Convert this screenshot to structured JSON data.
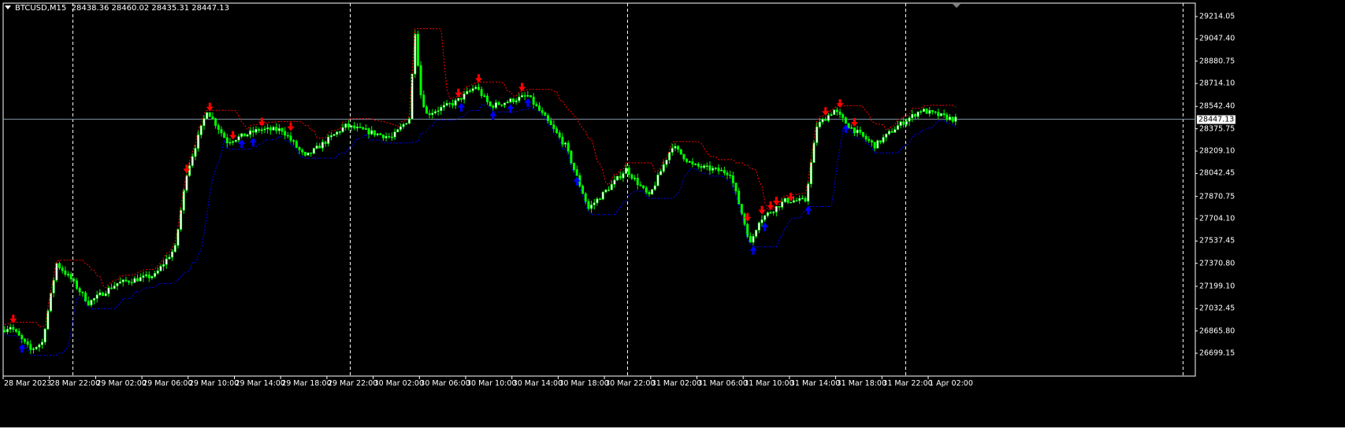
{
  "window": {
    "symbol_timeframe": "BTCUSD,M15",
    "ohlc": "28438.36 28460.02 28435.31 28447.13",
    "menu_icon": "triangle-down-icon"
  },
  "colors": {
    "background": "#000000",
    "candle": "#00ff00",
    "candle_alt": "#ffffff",
    "upper_band": "#ff0000",
    "lower_band": "#0000ff",
    "sell_arrow": "#ff0000",
    "buy_arrow": "#0000ff",
    "bid_line": "#8090a0",
    "grid": "#ffffff"
  },
  "chart_data": {
    "type": "candlestick",
    "timeframe": "M15",
    "price_axis": {
      "ticks": [
        "29214.05",
        "29047.40",
        "28880.75",
        "28714.10",
        "28542.40",
        "28375.75",
        "28209.10",
        "28042.45",
        "27870.75",
        "27704.10",
        "27537.45",
        "27370.80",
        "27199.10",
        "27032.45",
        "26865.80",
        "26699.15"
      ],
      "range": [
        26699.15,
        29214.05
      ]
    },
    "bid_price": "28447.13",
    "time_axis": {
      "ticks": [
        "28 Mar 2023",
        "28 Mar 22:00",
        "29 Mar 02:00",
        "29 Mar 06:00",
        "29 Mar 10:00",
        "29 Mar 14:00",
        "29 Mar 18:00",
        "29 Mar 22:00",
        "30 Mar 02:00",
        "30 Mar 06:00",
        "30 Mar 10:00",
        "30 Mar 14:00",
        "30 Mar 18:00",
        "30 Mar 22:00",
        "31 Mar 02:00",
        "31 Mar 06:00",
        "31 Mar 10:00",
        "31 Mar 14:00",
        "31 Mar 18:00",
        "31 Mar 22:00",
        "1 Apr 02:00"
      ],
      "start": "28 Mar 2023 18:00",
      "day_separators": [
        "29 Mar 00:00",
        "30 Mar 00:00",
        "31 Mar 00:00",
        "1 Apr 00:00",
        "2 Apr 00:00"
      ]
    },
    "price_path": [
      [
        "28 Mar 18:00",
        26870
      ],
      [
        "28 Mar 18:45",
        26900
      ],
      [
        "28 Mar 20:30",
        26723
      ],
      [
        "28 Mar 21:30",
        26780
      ],
      [
        "28 Mar 22:45",
        27369
      ],
      [
        "29 Mar 00:00",
        27252
      ],
      [
        "29 Mar 01:30",
        27076
      ],
      [
        "29 Mar 04:00",
        27222
      ],
      [
        "29 Mar 07:15",
        27281
      ],
      [
        "29 Mar 09:00",
        27487
      ],
      [
        "29 Mar 10:00",
        28045
      ],
      [
        "29 Mar 11:45",
        28515
      ],
      [
        "29 Mar 13:30",
        28280
      ],
      [
        "29 Mar 16:15",
        28368
      ],
      [
        "29 Mar 18:15",
        28368
      ],
      [
        "29 Mar 20:15",
        28163
      ],
      [
        "29 Mar 23:45",
        28397
      ],
      [
        "30 Mar 03:45",
        28309
      ],
      [
        "30 Mar 05:15",
        28456
      ],
      [
        "30 Mar 05:45",
        29102
      ],
      [
        "30 Mar 06:15",
        28632
      ],
      [
        "30 Mar 06:45",
        28485
      ],
      [
        "30 Mar 09:15",
        28574
      ],
      [
        "30 Mar 11:00",
        28691
      ],
      [
        "30 Mar 12:15",
        28544
      ],
      [
        "30 Mar 15:30",
        28621
      ],
      [
        "30 Mar 17:00",
        28456
      ],
      [
        "30 Mar 18:45",
        28250
      ],
      [
        "30 Mar 20:45",
        27780
      ],
      [
        "30 Mar 22:45",
        27956
      ],
      [
        "31 Mar 00:00",
        28074
      ],
      [
        "31 Mar 02:00",
        27868
      ],
      [
        "31 Mar 04:00",
        28250
      ],
      [
        "31 Mar 05:45",
        28103
      ],
      [
        "31 Mar 09:00",
        28045
      ],
      [
        "31 Mar 10:45",
        27516
      ],
      [
        "31 Mar 11:30",
        27692
      ],
      [
        "31 Mar 13:45",
        27839
      ],
      [
        "31 Mar 15:30",
        27839
      ],
      [
        "31 Mar 16:30",
        28397
      ],
      [
        "31 Mar 18:00",
        28515
      ],
      [
        "31 Mar 19:15",
        28397
      ],
      [
        "31 Mar 21:30",
        28250
      ],
      [
        "31 Mar 23:30",
        28397
      ],
      [
        "1 Apr 01:30",
        28515
      ],
      [
        "1 Apr 04:15",
        28447
      ]
    ],
    "sell_signals": [
      "28 Mar 18:45",
      "29 Mar 09:45",
      "29 Mar 11:45",
      "29 Mar 13:45",
      "29 Mar 16:15",
      "29 Mar 18:45",
      "30 Mar 09:15",
      "30 Mar 11:00",
      "30 Mar 14:45",
      "31 Mar 10:15",
      "31 Mar 11:30",
      "31 Mar 12:15",
      "31 Mar 12:45",
      "31 Mar 14:00",
      "31 Mar 17:00",
      "31 Mar 18:15",
      "31 Mar 19:30"
    ],
    "buy_signals": [
      "28 Mar 19:30",
      "29 Mar 14:30",
      "29 Mar 15:30",
      "30 Mar 09:30",
      "30 Mar 12:15",
      "30 Mar 13:45",
      "30 Mar 15:15",
      "30 Mar 19:30",
      "31 Mar 10:45",
      "31 Mar 11:45",
      "31 Mar 15:30",
      "31 Mar 18:45"
    ],
    "grid": false
  }
}
